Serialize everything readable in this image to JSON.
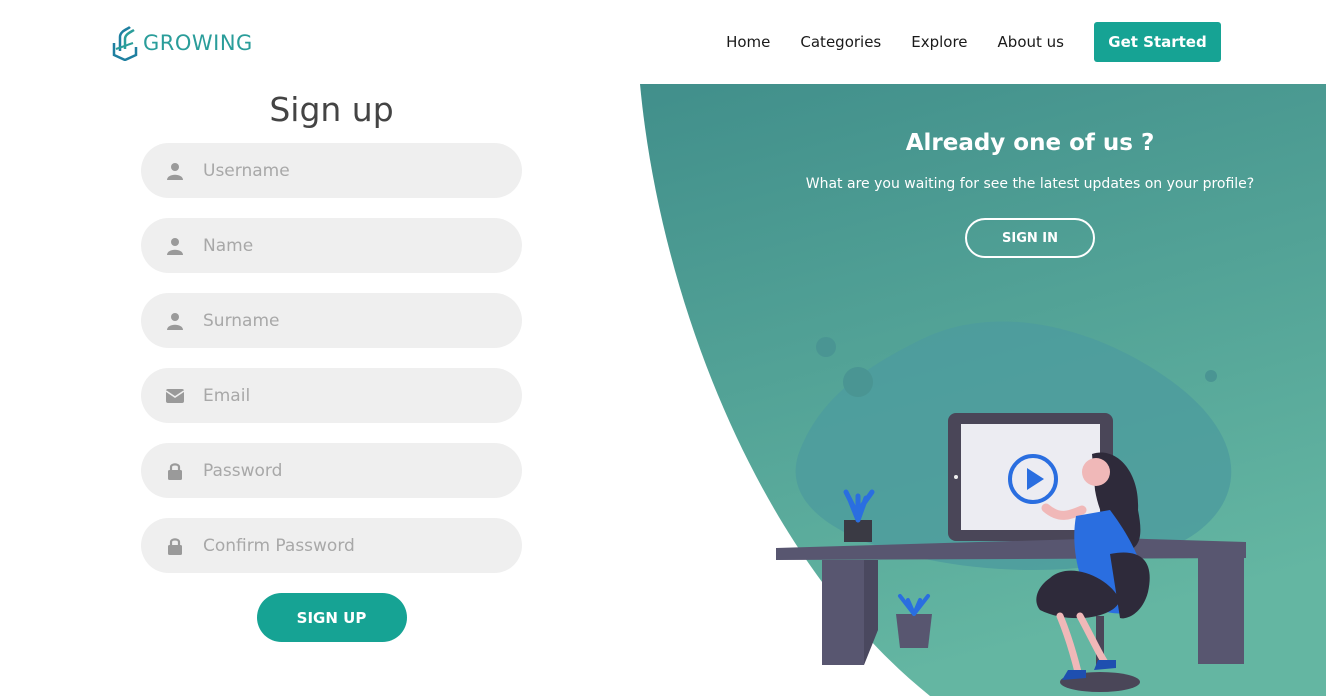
{
  "brand": {
    "name": "GROWING",
    "color": "#2a9d9a"
  },
  "nav": {
    "items": [
      "Home",
      "Categories",
      "Explore",
      "About us"
    ],
    "cta": "Get Started"
  },
  "form": {
    "title": "Sign up",
    "fields": [
      {
        "placeholder": "Username",
        "icon": "user-icon",
        "type": "text"
      },
      {
        "placeholder": "Name",
        "icon": "user-icon",
        "type": "text"
      },
      {
        "placeholder": "Surname",
        "icon": "user-icon",
        "type": "text"
      },
      {
        "placeholder": "Email",
        "icon": "envelope-icon",
        "type": "email"
      },
      {
        "placeholder": "Password",
        "icon": "lock-icon",
        "type": "password"
      },
      {
        "placeholder": "Confirm Password",
        "icon": "lock-icon",
        "type": "password"
      }
    ],
    "submit": "SIGN UP"
  },
  "signin": {
    "title": "Already one of us ?",
    "subtitle": "What are you waiting for see the latest updates on your profile?",
    "button": "SIGN IN"
  },
  "colors": {
    "accent": "#16a394",
    "panel_top": "#418f8b",
    "panel_bottom": "#63b5a3",
    "field_bg": "#efefef"
  }
}
